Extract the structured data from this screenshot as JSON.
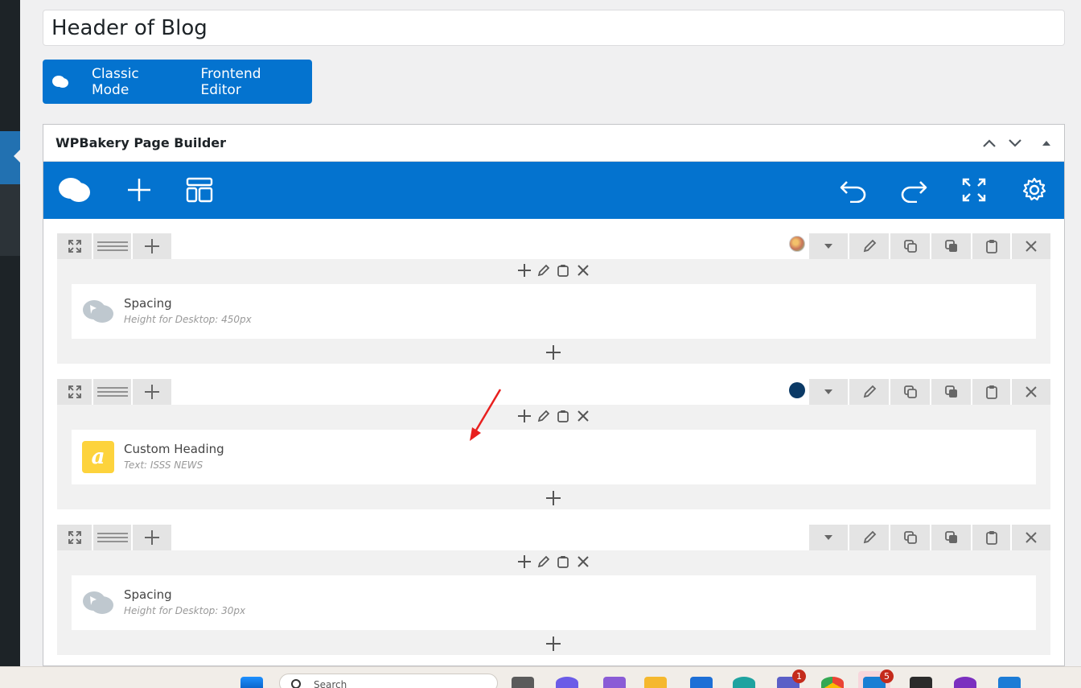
{
  "post": {
    "title": "Header of Blog"
  },
  "modes": {
    "classic_label": "Classic Mode",
    "frontend_label": "Frontend Editor"
  },
  "builder": {
    "title": "WPBakery Page Builder"
  },
  "rows": [
    {
      "element": {
        "title": "Spacing",
        "subtitle": "Height for Desktop: 450px",
        "icon": "spacing-cloud-icon"
      },
      "indicator": "image-thumbnail"
    },
    {
      "element": {
        "title": "Custom Heading",
        "subtitle": "Text: ISSS NEWS",
        "icon": "custom-heading-icon",
        "icon_letter": "a"
      },
      "indicator": "color-dot",
      "indicator_color": "#0b3a66"
    },
    {
      "element": {
        "title": "Spacing",
        "subtitle": "Height for Desktop: 30px",
        "icon": "spacing-cloud-icon"
      },
      "indicator": null
    }
  ],
  "taskbar": {
    "search_text": "Search",
    "badges": [
      "1",
      "5"
    ]
  },
  "colors": {
    "brand_blue": "#0473cf",
    "heading_icon": "#fdd33c",
    "annotation_arrow": "#e8201f"
  }
}
